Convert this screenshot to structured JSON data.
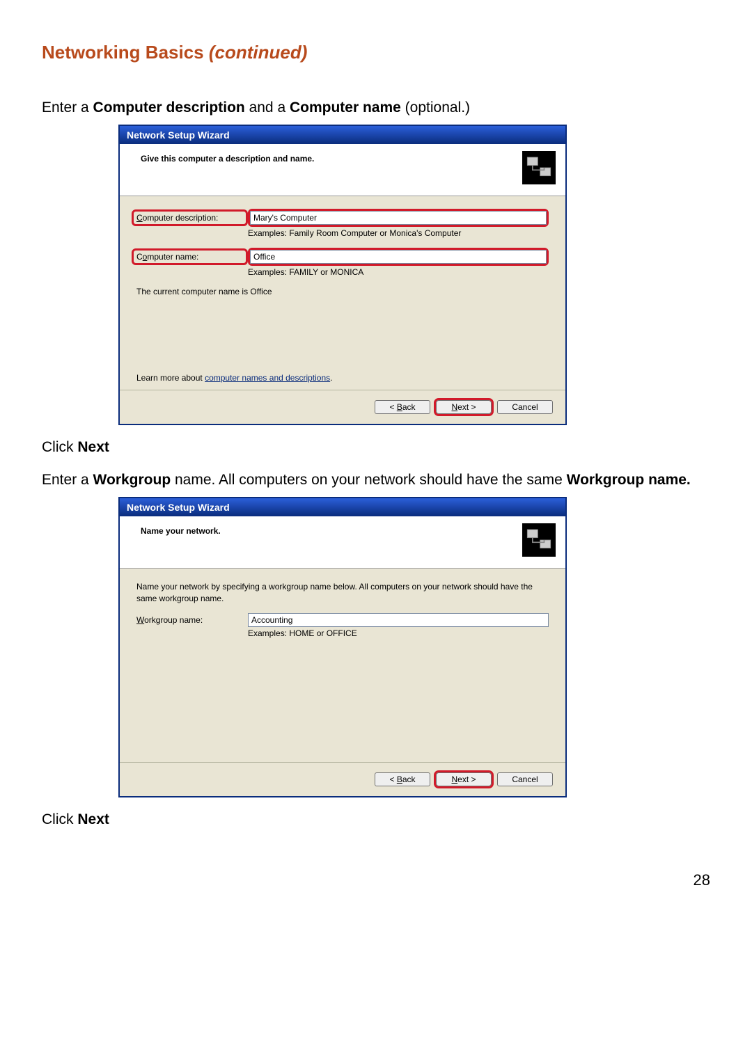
{
  "page": {
    "heading_main": "Networking Basics ",
    "heading_em": "(continued)",
    "instr1_a": "Enter a ",
    "instr1_b": "Computer description",
    "instr1_c": " and a ",
    "instr1_d": "Computer name",
    "instr1_e": " (optional.)",
    "click_next": "Click ",
    "next_bold": "Next",
    "instr2_a": "Enter a ",
    "instr2_b": "Workgroup",
    "instr2_c": " name.  All computers on your network should have the same ",
    "instr2_d": "Workgroup name.",
    "pagenum": "28"
  },
  "wiz1": {
    "title": "Network Setup Wizard",
    "header": "Give this computer a description and name.",
    "desc_label": "Computer description:",
    "desc_value": "Mary's Computer",
    "desc_example": "Examples: Family Room Computer or Monica's Computer",
    "name_label": "Computer name:",
    "name_value": "Office",
    "name_example": "Examples: FAMILY or MONICA",
    "current": "The current computer name is Office",
    "learn_pre": "Learn more about ",
    "learn_link": "computer names and descriptions",
    "learn_post": ".",
    "back": "< Back",
    "next": "Next >",
    "cancel": "Cancel"
  },
  "wiz2": {
    "title": "Network Setup Wizard",
    "header": "Name your network.",
    "desc": "Name your network by specifying a workgroup name below. All computers on your network should have the same workgroup name.",
    "wg_label": "Workgroup name:",
    "wg_value": "Accounting",
    "wg_example": "Examples: HOME or OFFICE",
    "back": "< Back",
    "next": "Next >",
    "cancel": "Cancel"
  }
}
